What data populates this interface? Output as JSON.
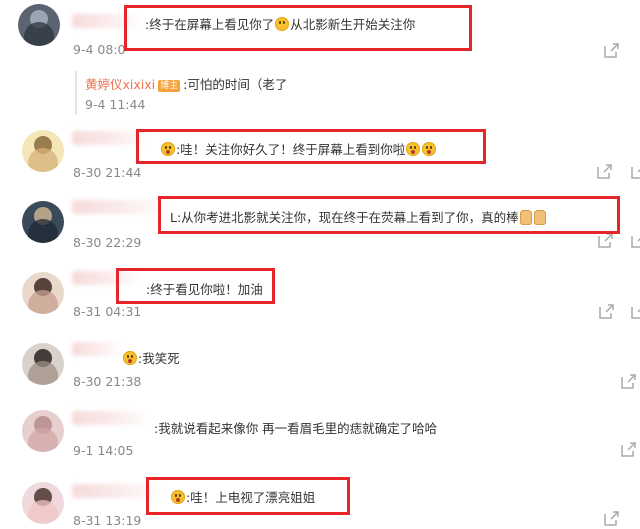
{
  "comments": [
    {
      "text": ":终于在屏幕上看见你了",
      "text_tail": "从北影新生开始关注你",
      "time": "9-4 08:0"
    },
    {
      "reply_name": "黄婷仪xixixi",
      "reply_badge": "博主",
      "text": ":可怕的时间（老了",
      "time": "9-4 11:44"
    },
    {
      "text": ":哇！关注你好久了！终于屏幕上看到你啦",
      "time": "8-30 21:44"
    },
    {
      "text": "L:从你考进北影就关注你，现在终于在荧幕上看到了你，真的棒",
      "time": "8-30 22:29"
    },
    {
      "text": ":终于看见你啦！加油",
      "time": "8-31 04:31"
    },
    {
      "text": ":我笑死",
      "time": "8-30 21:38"
    },
    {
      "text": ":我就说看起来像你 再一看眉毛里的痣就确定了哈哈",
      "time": "9-1 14:05"
    },
    {
      "text": ":哇！上电视了漂亮姐姐",
      "time": "8-31 13:19"
    }
  ],
  "icons": {
    "share": "share-icon",
    "emoji": "emoji-icon",
    "thumbs_up": "thumbs-up-icon"
  },
  "colors": {
    "highlight": "#e5252a",
    "reply_name": "#eb7350",
    "badge": "#f4a23a",
    "time": "#888888"
  }
}
